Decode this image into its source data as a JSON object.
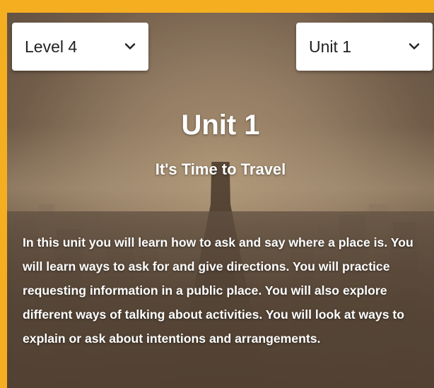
{
  "level_select": {
    "value": "Level 4",
    "icon": "chevron-down-icon"
  },
  "unit_select": {
    "value": "Unit 1",
    "icon": "chevron-down-icon"
  },
  "unit": {
    "title": "Unit 1",
    "subtitle": "It's Time to Travel",
    "description": "In this unit you will learn how to ask and say where a place is. You will learn ways to ask for and give directions. You will practice requesting information in a public place. You will also explore different ways of talking about activities. You will look at ways to explain or ask about intentions and arrangements."
  },
  "colors": {
    "frame_border": "#F6AE21",
    "text": "#FFFFFF",
    "select_bg": "#FFFFFF"
  }
}
